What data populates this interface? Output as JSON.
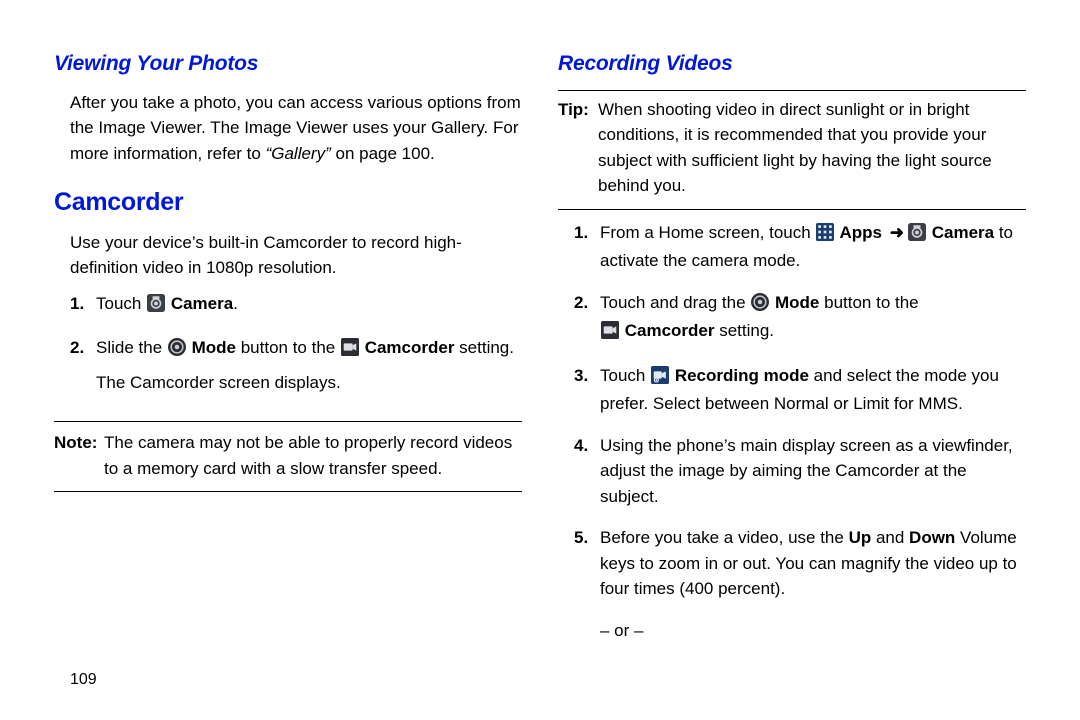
{
  "left": {
    "h_view": "Viewing Your Photos",
    "view_body_a": "After you take a photo, you can access various options from the Image Viewer. The Image Viewer uses your Gallery. For more information, refer to ",
    "gallery_ref": "“Gallery” ",
    "view_body_b": "on page 100.",
    "h_cam": "Camcorder",
    "cam_body": "Use your device’s built-in Camcorder to record high-definition video in 1080p resolution.",
    "step1_a": "Touch ",
    "step1_b": " Camera",
    "step1_c": ".",
    "step2_a": "Slide the ",
    "step2_b": " Mode",
    "step2_c": " button to the ",
    "step2_d": " Camcorder",
    "step2_e": " setting.",
    "step2_f": "The Camcorder screen displays.",
    "note_label": "Note:",
    "note_text": "The camera may not be able to properly record videos to a memory card with a slow transfer speed."
  },
  "right": {
    "h_rec": "Recording Videos",
    "tip_label": "Tip:",
    "tip_text": "When shooting video in direct sunlight or in bright conditions, it is recommended that you provide your subject with sufficient light by having the light source behind you.",
    "s1_a": "From a Home screen, touch ",
    "s1_apps": " Apps ",
    "s1_arrow": "➜",
    "s1_cam": " Camera",
    "s1_b": " to activate the camera mode.",
    "s2_a": "Touch and drag the ",
    "s2_mode": " Mode",
    "s2_b": " button to the ",
    "s2_camcorder": " Camcorder",
    "s2_c": " setting.",
    "s3_a": "Touch ",
    "s3_rec": " Recording mode",
    "s3_b": " and select the mode you prefer. Select between Normal or Limit for MMS.",
    "s4": "Using the phone’s main display screen as a viewfinder, adjust the image by aiming the Camcorder at the subject.",
    "s5_a": "Before you take a video, use the ",
    "s5_up": "Up",
    "s5_b": " and ",
    "s5_down": "Down",
    "s5_c": " Volume keys to zoom in or out. You can magnify the video up to four times (400 percent).",
    "or_line": "– or –"
  },
  "nums": {
    "n1": "1.",
    "n2": "2.",
    "n3": "3.",
    "n4": "4.",
    "n5": "5."
  },
  "page_number": "109"
}
